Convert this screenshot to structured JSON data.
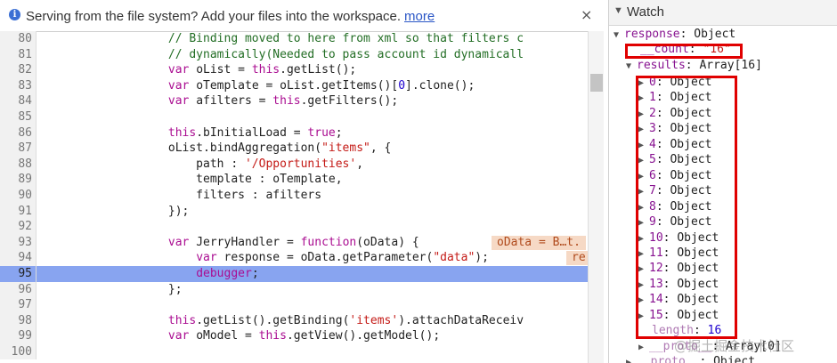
{
  "infobar": {
    "message": "Serving from the file system? Add your files into the workspace.",
    "link": "more",
    "close": "×"
  },
  "code": {
    "lines": [
      {
        "n": "80",
        "text": "                  // Binding moved to here from xml so that filters c"
      },
      {
        "n": "81",
        "text": "                  // dynamically(Needed to pass account id dynamicall"
      },
      {
        "n": "82",
        "text": "                  var oList = this.getList();"
      },
      {
        "n": "83",
        "text": "                  var oTemplate = oList.getItems()[0].clone();"
      },
      {
        "n": "84",
        "text": "                  var afilters = this.getFilters();"
      },
      {
        "n": "85",
        "text": ""
      },
      {
        "n": "86",
        "text": "                  this.bInitialLoad = true;"
      },
      {
        "n": "87",
        "text": "                  oList.bindAggregation(\"items\", {"
      },
      {
        "n": "88",
        "text": "                      path : '/Opportunities',"
      },
      {
        "n": "89",
        "text": "                      template : oTemplate,"
      },
      {
        "n": "90",
        "text": "                      filters : afilters"
      },
      {
        "n": "91",
        "text": "                  });"
      },
      {
        "n": "92",
        "text": ""
      },
      {
        "n": "93",
        "text": "                  var JerryHandler = function(oData) {"
      },
      {
        "n": "94",
        "text": "                      var response = oData.getParameter(\"data\");"
      },
      {
        "n": "95",
        "text": "                      debugger;"
      },
      {
        "n": "96",
        "text": "                  };"
      },
      {
        "n": "97",
        "text": ""
      },
      {
        "n": "98",
        "text": "                  this.getList().getBinding('items').attachDataReceiv"
      },
      {
        "n": "99",
        "text": "                  var oModel = this.getView().getModel();"
      },
      {
        "n": "100",
        "text": ""
      }
    ],
    "inline_values": {
      "line93": "oData = B…t.",
      "line94": "re"
    }
  },
  "watch": {
    "title": "Watch",
    "response_label": "response",
    "response_type": "Object",
    "count_label": "__count",
    "count_value": "\"16\"",
    "results_label": "results",
    "results_type": "Array[16]",
    "items": [
      "0",
      "1",
      "2",
      "3",
      "4",
      "5",
      "6",
      "7",
      "8",
      "9",
      "10",
      "11",
      "12",
      "13",
      "14",
      "15"
    ],
    "item_type": "Object",
    "length_label": "length",
    "length_value": "16",
    "proto1_label": "__proto__",
    "proto1_value": "Array[0]",
    "proto2_label": "__proto__",
    "proto2_value": "Object"
  },
  "watermark": "@掘土掘金技术社区"
}
